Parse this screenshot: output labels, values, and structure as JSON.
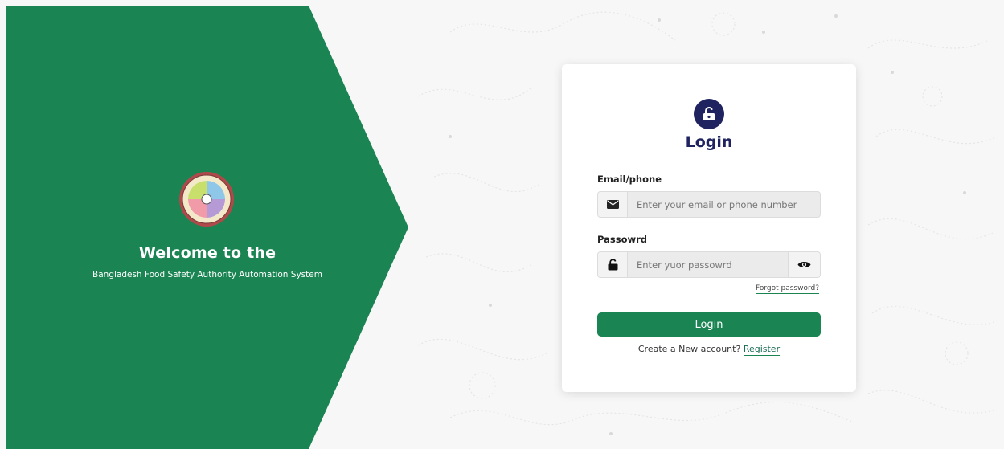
{
  "colors": {
    "brand_green": "#1a8452",
    "navy": "#1f2460",
    "background": "#f7f7f7"
  },
  "welcome": {
    "title": "Welcome to the",
    "subtitle": "Bangladesh Food Safety Authority Automation System",
    "logo_icon": "bfsa-emblem-logo"
  },
  "login_card": {
    "badge_icon": "unlock-icon",
    "title": "Login",
    "email_label": "Email/phone",
    "email_icon": "envelope-icon",
    "email_placeholder": "Enter your email or phone number",
    "email_value": "",
    "password_label": "Passowrd",
    "password_icon": "lock-icon",
    "password_placeholder": "Enter yuor passowrd",
    "password_value": "",
    "toggle_icon": "eye-icon",
    "forgot_label": "Forgot password?",
    "login_button": "Login",
    "register_prompt": "Create a New account?",
    "register_link": "Register"
  }
}
